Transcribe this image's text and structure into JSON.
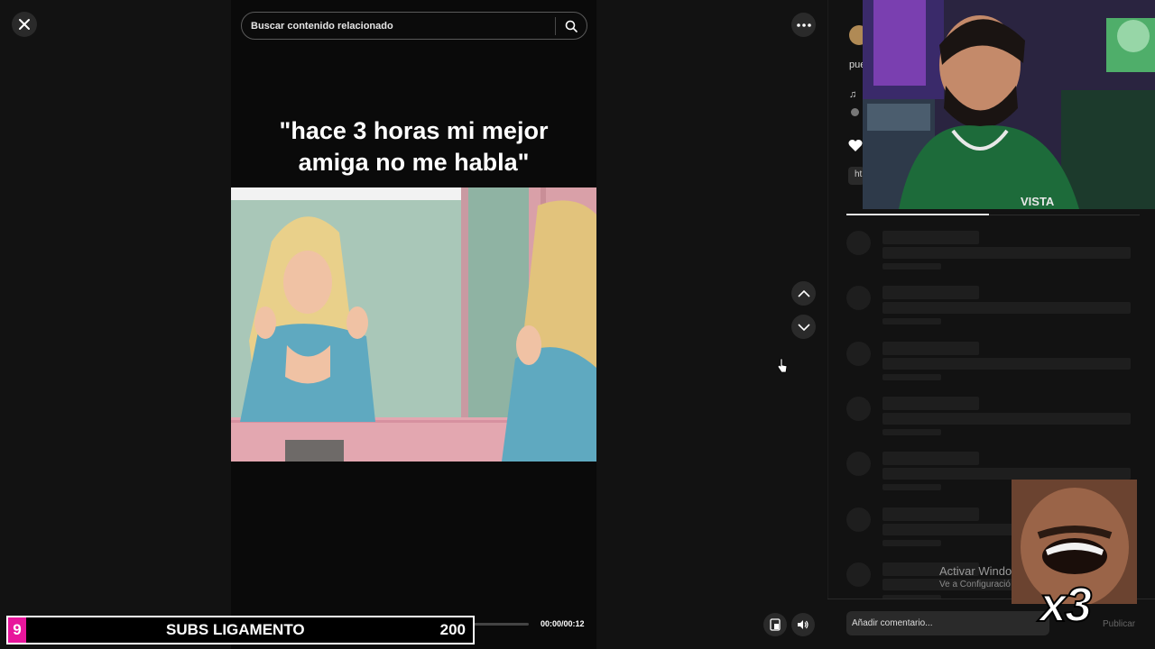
{
  "viewer": {
    "search_placeholder": "Buscar contenido relacionado",
    "caption_line1": "\"hace 3 horas mi mejor",
    "caption_line2": "amiga no me habla\"",
    "time": "00:00/00:12"
  },
  "panel": {
    "description": "pue hu",
    "link_chip": "ht",
    "skeleton_rows": 7,
    "comment_placeholder": "Añadir comentario...",
    "publish_label": "Publicar"
  },
  "overlay": {
    "subs_count": "9",
    "subs_label": "SUBS LIGAMENTO",
    "subs_goal": "200",
    "windows_activate": "Activar Windo",
    "windows_activate_sub": "Ve a Configuració",
    "meme_label": "x3",
    "jersey_text": "VISTA"
  },
  "colors": {
    "background": "#121212",
    "subs_accent": "#e8169c",
    "jersey_green": "#1d6b3a"
  }
}
